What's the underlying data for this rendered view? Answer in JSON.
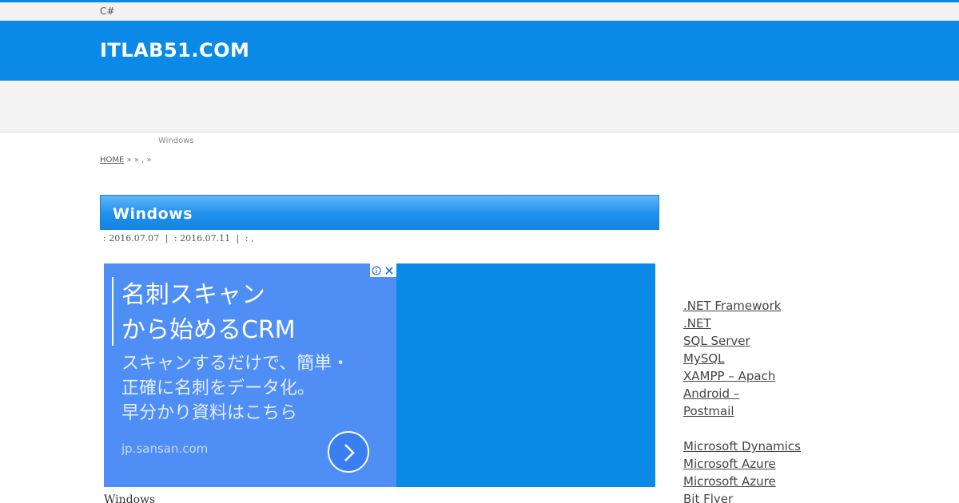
{
  "topbar": {
    "text": "C#"
  },
  "header": {
    "site_title": "ITLAB51.COM"
  },
  "subtitle": "Windows",
  "breadcrumb": {
    "home": "HOME",
    "rest": " »   » , »"
  },
  "post": {
    "title": "Windows",
    "published": ": 2016.07.07",
    "sep1": "|",
    "updated": ": 2016.07.11",
    "sep2": "|",
    "category": ":          ,",
    "body_start": "Windows"
  },
  "ad": {
    "headline_line1": "名刺スキャン",
    "headline_line2": "から始めるCRM",
    "desc_line1": "スキャンするだけで、簡単・",
    "desc_line2": "正確に名刺をデータ化。",
    "desc_line3": "早分かり資料はこちら",
    "domain": "jp.sansan.com",
    "bg_color": "#4f8ef5",
    "icons": [
      "info-icon",
      "close-icon",
      "chevron-right-icon"
    ]
  },
  "sidebar": {
    "group1": [
      ".NET Framework",
      ".NET ",
      "SQL Server",
      "MySQL",
      "XAMPP – Apach",
      "Android – ",
      "Postmail"
    ],
    "group2": [
      "Microsoft Dynamics",
      "Microsoft Azure",
      "Microsoft Azure",
      "Bit Flyer"
    ]
  },
  "colors": {
    "brand": "#0a8ae6",
    "title_bar": "#1e90ee",
    "nav_bg": "#f4f4f4"
  }
}
